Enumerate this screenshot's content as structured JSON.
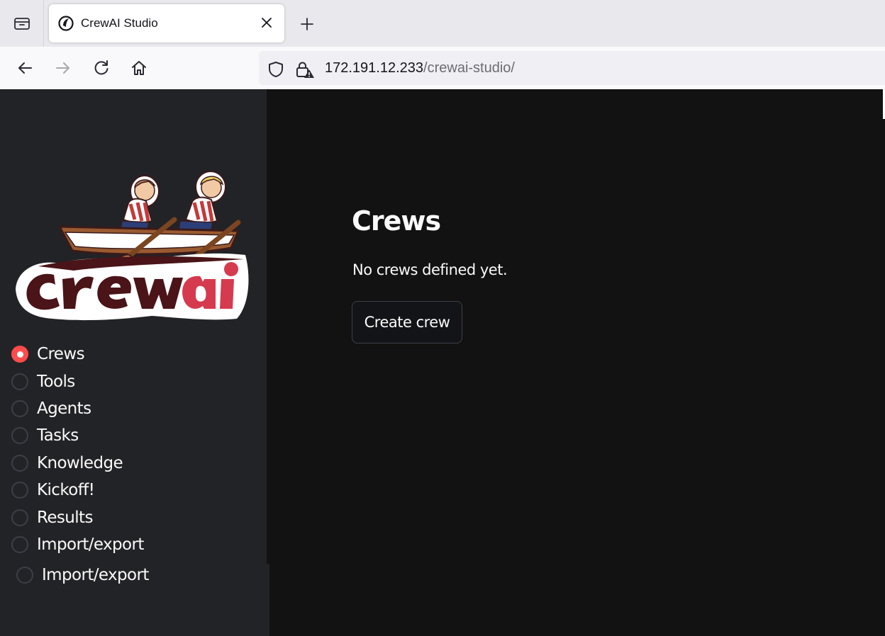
{
  "browser": {
    "tab_title": "CrewAI Studio",
    "url_host": "172.191.12.233",
    "url_path": "/crewai-studio/"
  },
  "logo_text": "crewai",
  "sidebar": {
    "items": [
      {
        "label": "Crews",
        "selected": true
      },
      {
        "label": "Tools",
        "selected": false
      },
      {
        "label": "Agents",
        "selected": false
      },
      {
        "label": "Tasks",
        "selected": false
      },
      {
        "label": "Knowledge",
        "selected": false
      },
      {
        "label": "Kickoff!",
        "selected": false
      },
      {
        "label": "Results",
        "selected": false
      },
      {
        "label": "Import/export",
        "selected": false
      }
    ],
    "extra_item": {
      "label": "Import/export",
      "selected": false
    }
  },
  "main": {
    "title": "Crews",
    "empty_message": "No crews defined yet.",
    "create_button": "Create crew"
  },
  "colors": {
    "accent": "#ff4b4b",
    "sidebar_bg": "#222327",
    "main_bg": "#121212",
    "logo_red": "#d63a4f",
    "logo_dark": "#4a1418"
  },
  "icons": [
    "tab-list-icon",
    "crewai-favicon-icon",
    "close-icon",
    "plus-icon",
    "back-arrow-icon",
    "forward-arrow-icon",
    "reload-icon",
    "home-icon",
    "shield-icon",
    "lock-warning-icon"
  ]
}
